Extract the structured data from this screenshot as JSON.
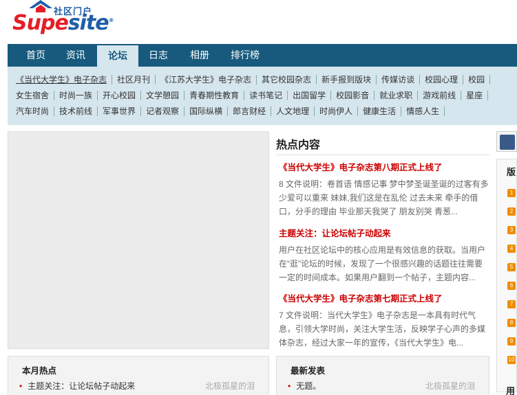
{
  "logo": {
    "portal_text": "社区门户",
    "name_red": "Supe",
    "name_blue": "site",
    "trademark": "®"
  },
  "nav": {
    "items": [
      {
        "label": "首页"
      },
      {
        "label": "资讯"
      },
      {
        "label": "论坛",
        "active": true
      },
      {
        "label": "日志"
      },
      {
        "label": "相册"
      },
      {
        "label": "排行榜"
      }
    ]
  },
  "subnav": {
    "row1": [
      "《当代大学生》电子杂志",
      "社区月刊",
      "《江苏大学生》电子杂志",
      "其它校园杂志",
      "新手报到版块",
      "传媒访谈",
      "校园心理",
      "校园"
    ],
    "row2": [
      "女生宿舍",
      "时尚一族",
      "开心校园",
      "文学憩园",
      "青春期性教育",
      "读书笔记",
      "出国留学",
      "校园影音",
      "就业求职",
      "游戏前线",
      "星座"
    ],
    "row3": [
      "汽车时尚",
      "技术前线",
      "军事世界",
      "记者观察",
      "国际纵横",
      "郎言财经",
      "人文地理",
      "时尚伊人",
      "健康生活",
      "情感人生"
    ]
  },
  "hot": {
    "title": "热点内容",
    "articles": [
      {
        "title": "《当代大学生》电子杂志第八期正式上线了",
        "body": "8 文件说明：卷首语 情感记事 梦中梦圣诞圣诞的过客有多少爱可以重来 妹妹,我们这是在乱伦 过去未来 牵手的借口，分手的理由 毕业那天我哭了 朋友别哭 青葱..."
      },
      {
        "title": "主题关注：让论坛帖子动起来",
        "body": "用户在社区论坛中的核心应用是有效信息的获取。当用户在“逛”论坛的时候，发现了一个很感兴趣的话题往往需要一定的时间成本。如果用户翻到一个帖子，主题内容..."
      },
      {
        "title": "《当代大学生》电子杂志第七期正式上线了",
        "body": "7 文件说明：当代大学生》电子杂志是一本具有时代气息，引领大学时尚，关注大学生活，反映学子心声的多媒体杂志，经过大家一年的宣传，《当代大学生》电..."
      }
    ]
  },
  "right": {
    "rank_title": "版",
    "rank_numbers": [
      "1",
      "2",
      "3",
      "4",
      "5",
      "6",
      "7",
      "8",
      "9",
      "10"
    ],
    "bottom_title": "用"
  },
  "month_hot": {
    "title": "本月热点",
    "item": "主题关注：让论坛帖子动起来",
    "author": "北极孤星的泪"
  },
  "latest": {
    "title": "最新发表",
    "item": "无题。",
    "author": "北极孤星的泪"
  }
}
